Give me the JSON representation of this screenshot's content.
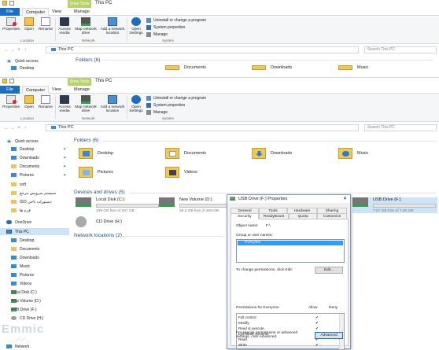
{
  "back_window": {
    "title": "This PC",
    "context_tab": "Drive Tools",
    "tabs": {
      "file": "File",
      "computer": "Computer",
      "view": "View",
      "manage": "Manage"
    },
    "ribbon": {
      "properties": "Properties",
      "open": "Open",
      "rename": "Rename",
      "access_media": "Access media",
      "map_network_drive": "Map network drive",
      "add_network_location": "Add a network location",
      "open_settings": "Open Settings",
      "uninstall": "Uninstall or change a program",
      "system_properties": "System properties",
      "manage": "Manage",
      "group_location": "Location",
      "group_network": "Network",
      "group_system": "System"
    },
    "address": "This PC",
    "search_placeholder": "Search This PC",
    "nav": {
      "quick_access": "Quick access",
      "desktop": "Desktop"
    },
    "section_folders": "Folders (6)",
    "peek_folders": [
      "Documents",
      "Downloads",
      "Music"
    ]
  },
  "front_window": {
    "title": "This PC",
    "context_tab": "Drive Tools",
    "tabs": {
      "file": "File",
      "computer": "Computer",
      "view": "View",
      "manage": "Manage"
    },
    "ribbon": {
      "properties": "Properties",
      "open": "Open",
      "rename": "Rename",
      "access_media": "Access media",
      "map_network_drive": "Map network drive",
      "add_network_location": "Add a network location",
      "open_settings": "Open Settings",
      "uninstall": "Uninstall or change a program",
      "system_properties": "System properties",
      "manage": "Manage",
      "group_location": "Location",
      "group_network": "Network",
      "group_system": "System"
    },
    "address": "This PC",
    "search_placeholder": "Search This PC",
    "nav": {
      "quick_access": "Quick access",
      "items": [
        "Desktop",
        "Downloads",
        "Documents",
        "Pictures",
        "soft",
        "سیستم سرویس مرجع",
        "ISO دستورات ناجی",
        "فرم ها"
      ],
      "onedrive": "OneDrive",
      "this_pc": "This PC",
      "pc_items": [
        "Desktop",
        "Documents",
        "Downloads",
        "Music",
        "Pictures",
        "Videos",
        "Local Disk (C:)",
        "New Volume (D:)",
        "USB Drive (F:)",
        "CD Drive (H:)"
      ],
      "network": "Network"
    },
    "section_folders": "Folders (6)",
    "folders": [
      "Desktop",
      "Documents",
      "Downloads",
      "Music",
      "Pictures",
      "Videos"
    ],
    "section_devices": "Devices and drives (5)",
    "drives": [
      {
        "name": "Local Disk (C:)",
        "free": "109 GB free of 257 GB",
        "used_fraction": 0.58
      },
      {
        "name": "New Volume (D:)",
        "free": "28.4 GB free of 209 GB",
        "used_fraction": 0.86
      },
      {
        "name": "USB Drive (F:)",
        "free": "7.57 GB free of 7.60 GB",
        "used_fraction": 0.01
      }
    ],
    "cd_drive": "CD Drive (H:)",
    "section_network": "Network locations (2)"
  },
  "dialog": {
    "title": "USB Drive (F:) Properties",
    "tabs_row1": [
      "General",
      "Tools",
      "Hardware",
      "Sharing"
    ],
    "tabs_row2": [
      "Security",
      "ReadyBoost",
      "Quota",
      "Customize"
    ],
    "object_name_label": "Object name:",
    "object_name_value": "F:\\",
    "group_label": "Group or user names:",
    "selected_user": "Everyone",
    "change_perm_text": "To change permissions, click Edit.",
    "edit_button": "Edit...",
    "perm_for": "Permissions for Everyone",
    "allow": "Allow",
    "deny": "Deny",
    "permissions": [
      "Full control",
      "Modify",
      "Read & execute",
      "List folder contents",
      "Read",
      "Write"
    ],
    "check_glyph": "✔",
    "special_text": "For special permissions or advanced settings, click Advanced.",
    "advanced_button": "Advanced"
  },
  "watermark": {
    "big": "Emmic",
    "small": "ایران"
  }
}
